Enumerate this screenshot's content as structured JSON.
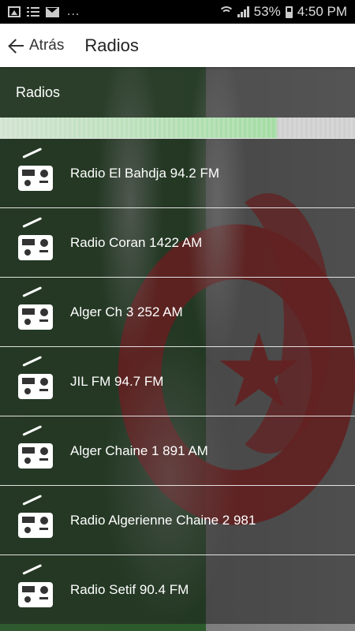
{
  "status_bar": {
    "battery": "53%",
    "time": "4:50 PM",
    "dots": "...",
    "left_icons": [
      "image-icon",
      "list-icon",
      "mail-icon"
    ],
    "right_icons": [
      "wifi-icon",
      "signal-icon",
      "battery-charging-icon"
    ]
  },
  "app_bar": {
    "back_label": "Atrás",
    "title": "Radios"
  },
  "section": {
    "header": "Radios",
    "progress": 0.78
  },
  "stations": [
    {
      "label": "Radio El Bahdja 94.2 FM",
      "icon": "radio-icon"
    },
    {
      "label": "Radio Coran 1422 AM",
      "icon": "radio-icon"
    },
    {
      "label": "Alger Ch 3 252 AM",
      "icon": "radio-icon"
    },
    {
      "label": "JIL FM 94.7 FM",
      "icon": "radio-icon"
    },
    {
      "label": "Alger Chaine 1 891 AM",
      "icon": "radio-icon"
    },
    {
      "label": "Radio Algerienne Chaine 2 981",
      "icon": "radio-icon"
    },
    {
      "label": "Radio Setif 90.4 FM",
      "icon": "radio-icon"
    }
  ],
  "colors": {
    "flag_green": "#2c5a2c",
    "flag_red": "#b42323",
    "appbar_bg": "#ffffff",
    "statusbar_bg": "#000000"
  }
}
